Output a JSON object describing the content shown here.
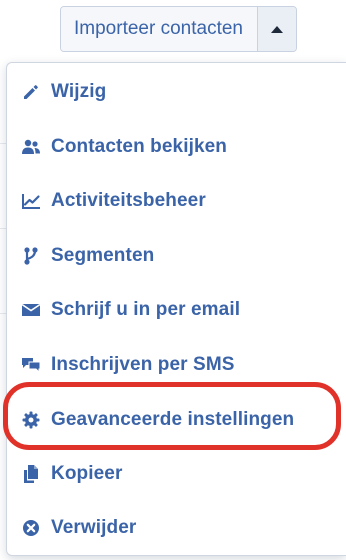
{
  "header": {
    "import_button_label": "Importeer contacten",
    "toggle_icon": "caret-up-icon"
  },
  "menu": {
    "items": [
      {
        "label": "Wijzig",
        "icon": "pencil-icon"
      },
      {
        "label": "Contacten bekijken",
        "icon": "users-icon"
      },
      {
        "label": "Activiteitsbeheer",
        "icon": "line-chart-icon"
      },
      {
        "label": "Segmenten",
        "icon": "branch-icon"
      },
      {
        "label": "Schrijf u in per email",
        "icon": "envelope-icon"
      },
      {
        "label": "Inschrijven per SMS",
        "icon": "chat-icon"
      },
      {
        "label": "Geavanceerde instellingen",
        "icon": "gear-icon"
      },
      {
        "label": "Kopieer",
        "icon": "copy-icon"
      },
      {
        "label": "Verwijder",
        "icon": "remove-circle-icon"
      }
    ],
    "highlighted_item": "Geavanceerde instellingen"
  },
  "colors": {
    "accent": "#3b64a8",
    "highlight": "#e1322a"
  }
}
